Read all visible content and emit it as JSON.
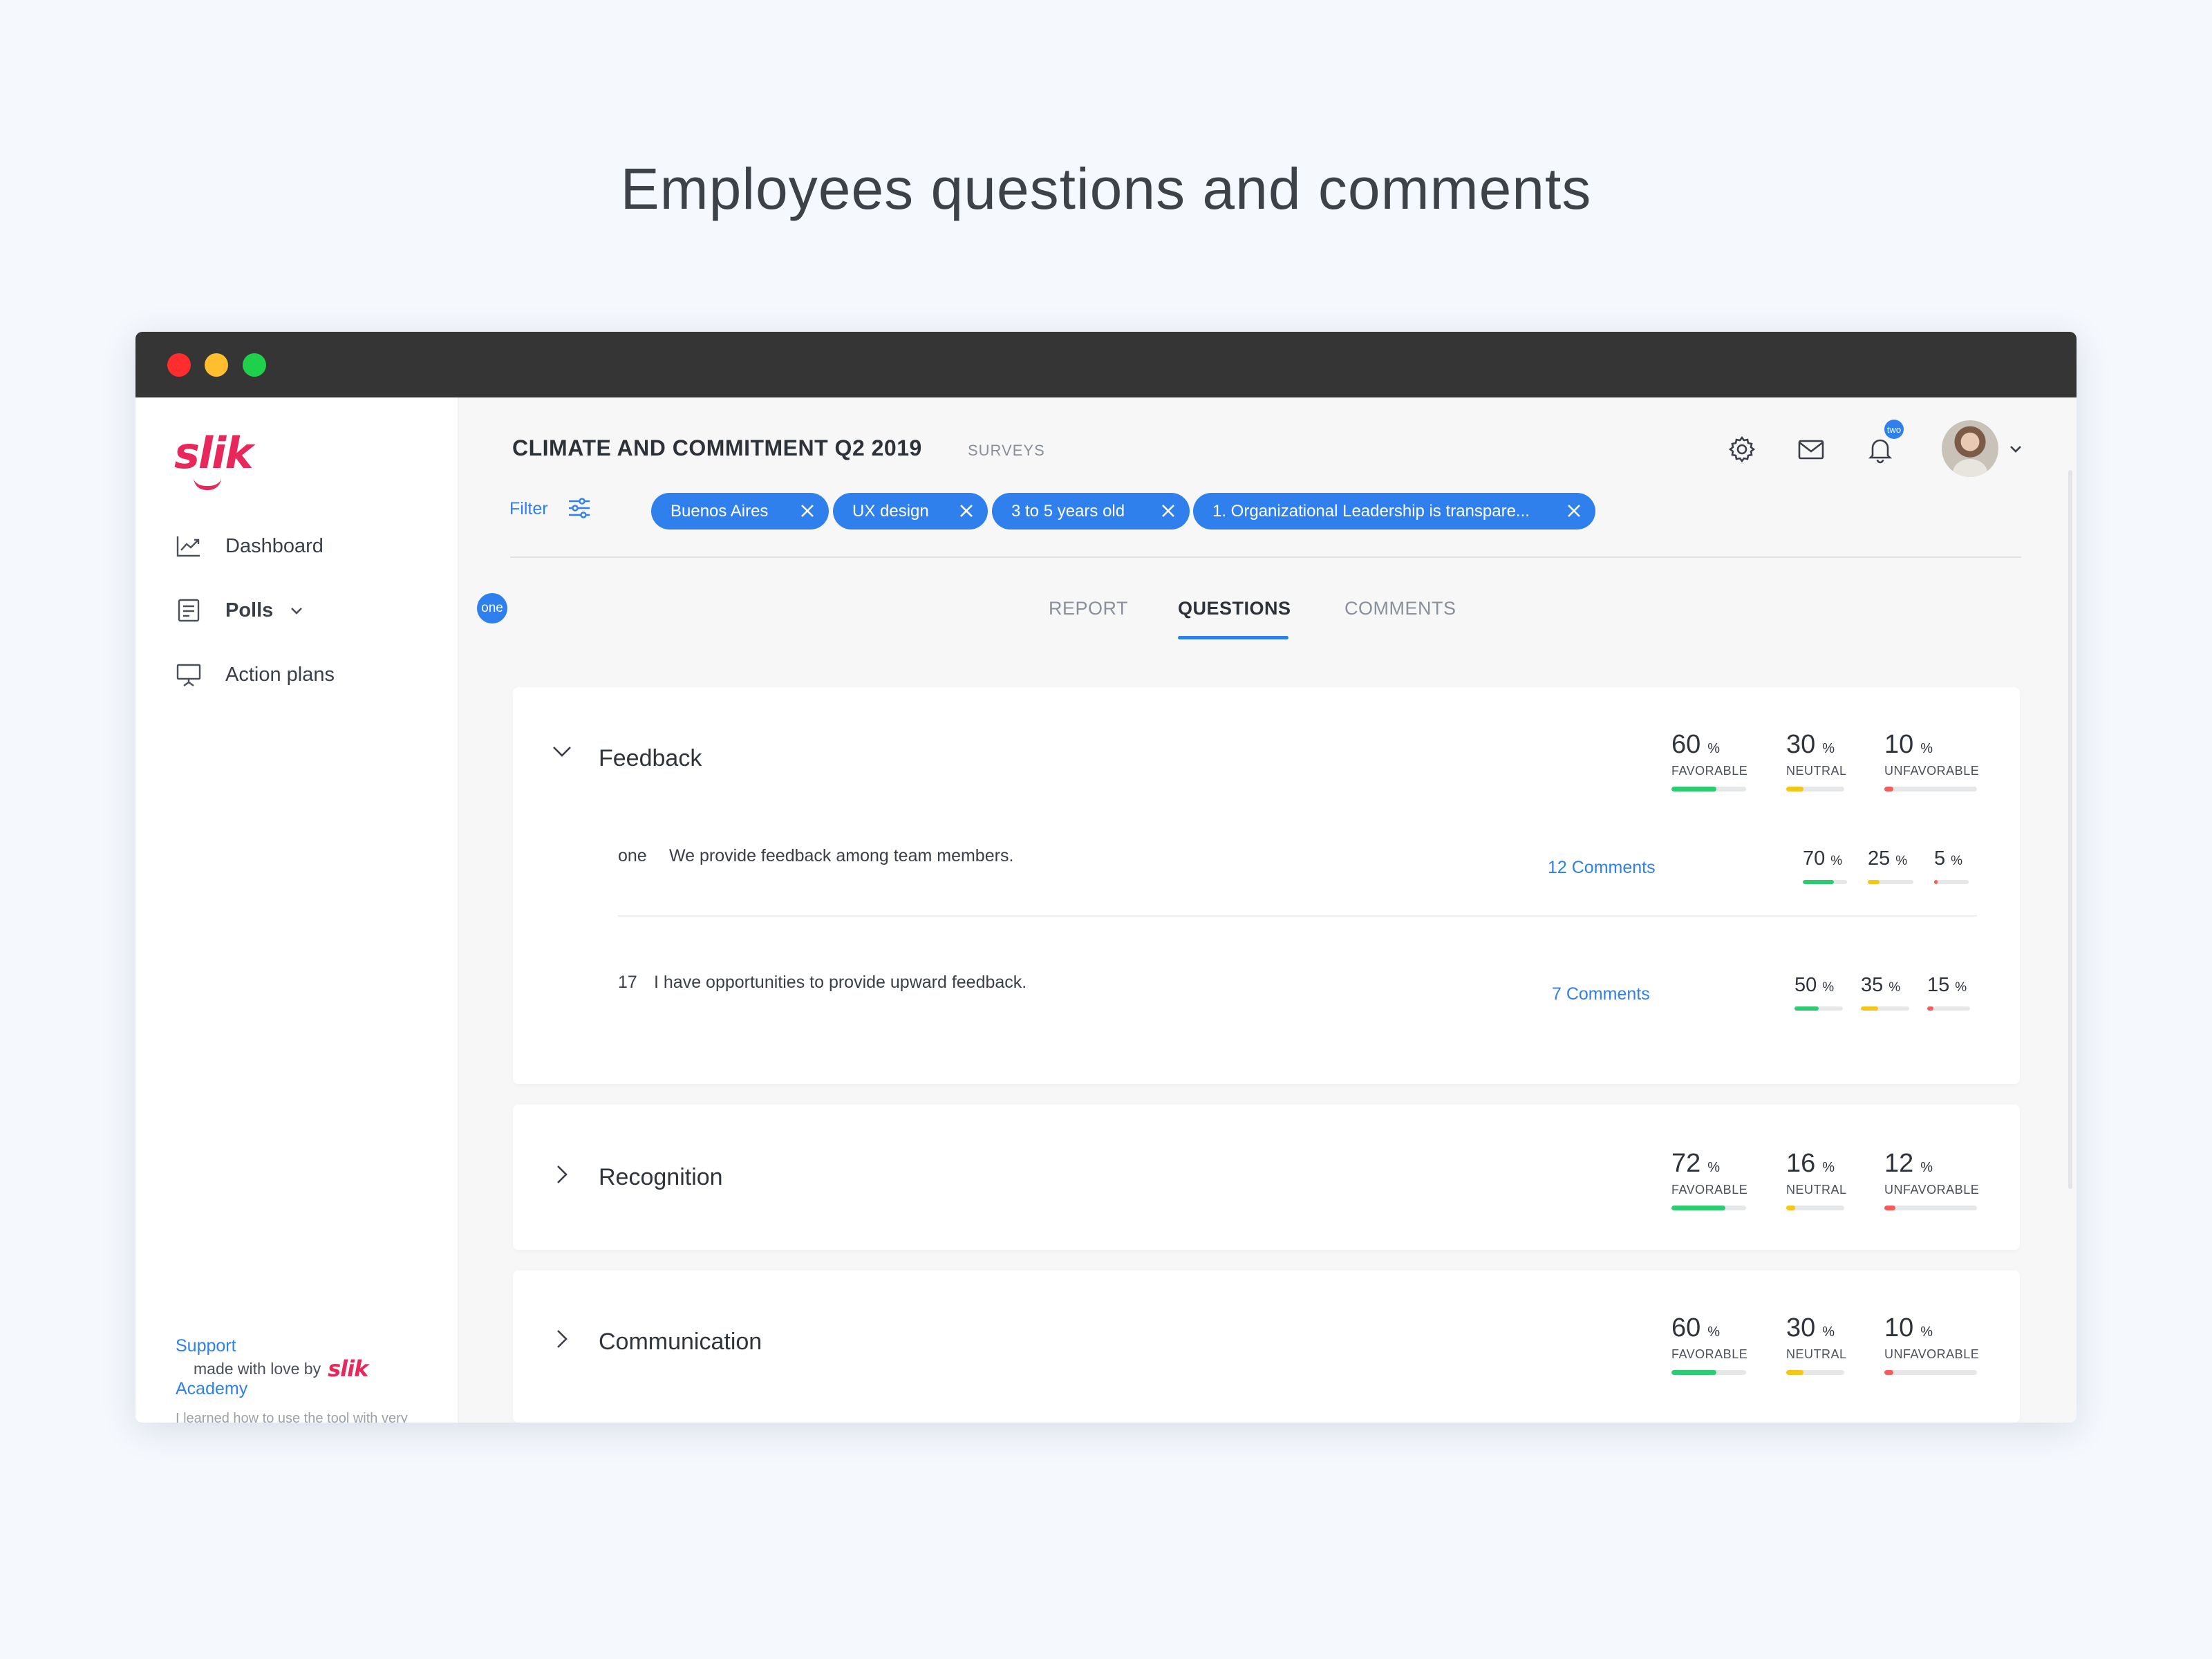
{
  "page": {
    "heading": "Employees questions and comments"
  },
  "sidebar": {
    "logo": "slik",
    "items": [
      {
        "label": "Dashboard",
        "icon": "chart-line-icon"
      },
      {
        "label": "Polls",
        "icon": "document-list-icon",
        "badge": "one",
        "expandable": true
      },
      {
        "label": "Action plans",
        "icon": "presentation-board-icon"
      }
    ],
    "support_label": "Support",
    "academy_label": "Academy",
    "academy_note": "I learned how to use the tool with very simple tutorials.",
    "footer_text": "made with love by",
    "footer_logo": "slik"
  },
  "header": {
    "title": "CLIMATE AND COMMITMENT Q2 2019",
    "subtitle": "SURVEYS",
    "notification_badge": "two"
  },
  "filter": {
    "label": "Filter",
    "chips": [
      "Buenos Aires",
      "UX design",
      "3 to 5 years old",
      "1. Organizational Leadership is transpare..."
    ]
  },
  "tabs": [
    {
      "label": "REPORT",
      "active": false
    },
    {
      "label": "QUESTIONS",
      "active": true
    },
    {
      "label": "COMMENTS",
      "active": false
    }
  ],
  "colors": {
    "accent": "#2f80ed",
    "brand": "#e8285a",
    "favorable": "#2ecc71",
    "neutral": "#f5c518",
    "unfavorable": "#f25c5c"
  },
  "categories": [
    {
      "title": "Feedback",
      "expanded": true,
      "stats": [
        {
          "value": "60",
          "unit": "%",
          "label": "FAVORABLE"
        },
        {
          "value": "30",
          "unit": "%",
          "label": "NEUTRAL"
        },
        {
          "value": "10",
          "unit": "%",
          "label": "UNFAVORABLE"
        }
      ],
      "questions": [
        {
          "number": "one",
          "text": "We provide feedback among team members.",
          "comments": "12 Comments",
          "stats": [
            {
              "value": "70",
              "unit": "%"
            },
            {
              "value": "25",
              "unit": "%"
            },
            {
              "value": "5",
              "unit": "%"
            }
          ]
        },
        {
          "number": "17",
          "text": "I have opportunities to provide upward feedback.",
          "comments": "7 Comments",
          "stats": [
            {
              "value": "50",
              "unit": "%"
            },
            {
              "value": "35",
              "unit": "%"
            },
            {
              "value": "15",
              "unit": "%"
            }
          ]
        }
      ]
    },
    {
      "title": "Recognition",
      "expanded": false,
      "stats": [
        {
          "value": "72",
          "unit": "%",
          "label": "FAVORABLE"
        },
        {
          "value": "16",
          "unit": "%",
          "label": "NEUTRAL"
        },
        {
          "value": "12",
          "unit": "%",
          "label": "UNFAVORABLE"
        }
      ]
    },
    {
      "title": "Communication",
      "expanded": false,
      "stats": [
        {
          "value": "60",
          "unit": "%",
          "label": "FAVORABLE"
        },
        {
          "value": "30",
          "unit": "%",
          "label": "NEUTRAL"
        },
        {
          "value": "10",
          "unit": "%",
          "label": "UNFAVORABLE"
        }
      ]
    }
  ]
}
